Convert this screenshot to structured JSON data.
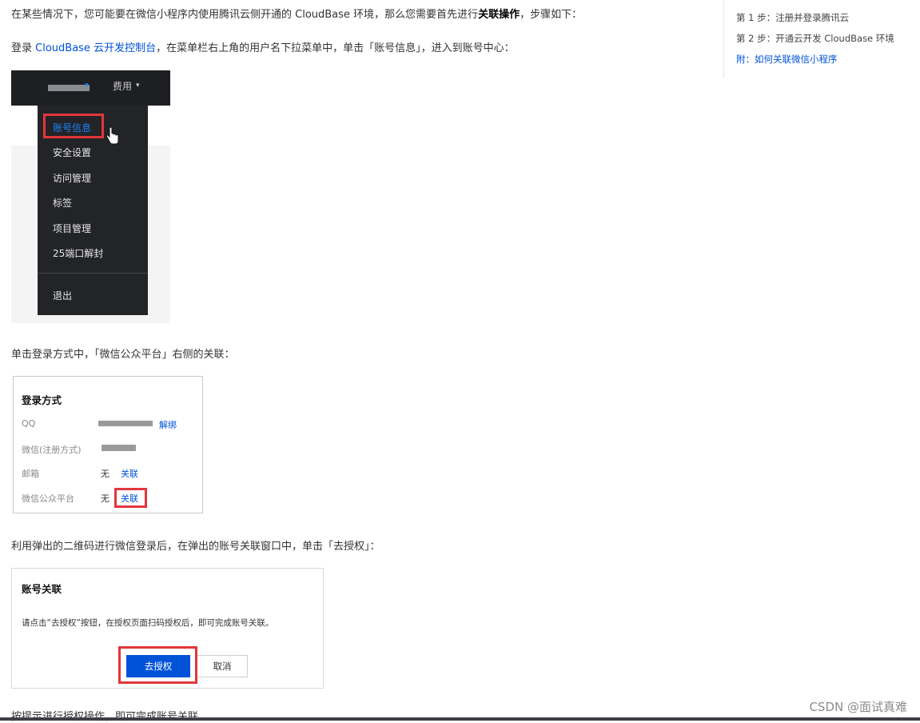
{
  "article": {
    "p1_text": "在某些情况下，您可能要在微信小程序内使用腾讯云侧开通的 CloudBase 环境，那么您需要首先进行",
    "p1_bold": "关联操作",
    "p1_tail": "，步骤如下：",
    "p2_prefix": "登录 ",
    "p2_link": "CloudBase 云开发控制台",
    "p2_tail": "，在菜单栏右上角的用户名下拉菜单中，单击「账号信息」，进入到账号中心：",
    "p3": "单击登录方式中，「微信公众平台」右侧的关联：",
    "p4": "利用弹出的二维码进行微信登录后，在弹出的账号关联窗口中，单击「去授权」：",
    "p5_partial": "按提示进行授权操作，即可完成账号关联。"
  },
  "toc": {
    "items": [
      {
        "label": "第 1 步：注册并登录腾讯云"
      },
      {
        "label": "第 2 步：开通云开发 CloudBase 环境"
      },
      {
        "label": "附：如何关联微信小程序"
      }
    ]
  },
  "screenshot_menu": {
    "fee_label": "费用",
    "items": [
      "账号信息",
      "安全设置",
      "访问管理",
      "标签",
      "项目管理",
      "25端口解封",
      "退出"
    ]
  },
  "screenshot_login": {
    "title": "登录方式",
    "rows": [
      {
        "label": "QQ",
        "value": "",
        "action": "解绑"
      },
      {
        "label": "微信(注册方式)",
        "value": "",
        "action": ""
      },
      {
        "label": "邮箱",
        "value": "无",
        "action": "关联"
      },
      {
        "label": "微信公众平台",
        "value": "无",
        "action": "关联"
      }
    ]
  },
  "screenshot_dialog": {
    "title": "账号关联",
    "desc": "请点击“去授权”按钮，在授权页面扫码授权后，即可完成账号关联。",
    "primary_button": "去授权",
    "cancel_button": "取消"
  },
  "watermark": "CSDN @面试真难",
  "colors": {
    "link": "#0052d9",
    "highlight": "#e2363c",
    "menu_bg": "#232428"
  }
}
